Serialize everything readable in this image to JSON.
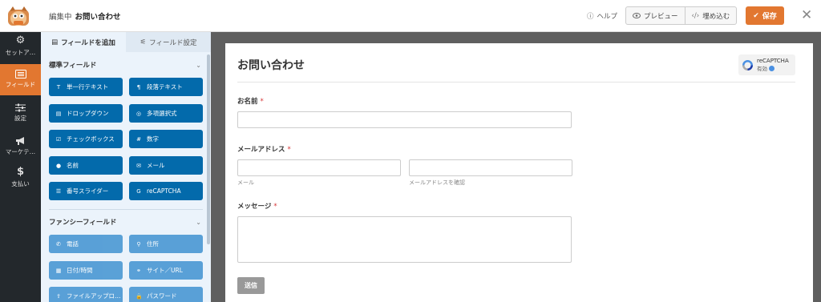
{
  "header": {
    "editing_label": "編集中",
    "form_name": "お問い合わせ",
    "help_label": "ヘルプ",
    "preview_label": "プレビュー",
    "embed_label": "埋め込む",
    "save_label": "保存",
    "close_label": "✕"
  },
  "leftnav": {
    "items": [
      {
        "label": "セットア…",
        "icon": "gear-icon"
      },
      {
        "label": "フィールド",
        "icon": "fields-icon"
      },
      {
        "label": "設定",
        "icon": "sliders-icon"
      },
      {
        "label": "マーケテ…",
        "icon": "megaphone-icon"
      },
      {
        "label": "支払い",
        "icon": "dollar-icon"
      }
    ],
    "active_index": 1
  },
  "panel": {
    "tabs": [
      "フィールドを追加",
      "フィールド設定"
    ],
    "standard_title": "標準フィールド",
    "standard_fields": [
      {
        "label": "単一行テキスト",
        "glyph": "T"
      },
      {
        "label": "段落テキスト",
        "glyph": "¶"
      },
      {
        "label": "ドロップダウン",
        "glyph": "▤"
      },
      {
        "label": "多項選択式",
        "glyph": "◎"
      },
      {
        "label": "チェックボックス",
        "glyph": "☑"
      },
      {
        "label": "数字",
        "glyph": "#"
      },
      {
        "label": "名前",
        "glyph": "●"
      },
      {
        "label": "メール",
        "glyph": "✉"
      },
      {
        "label": "番号スライダー",
        "glyph": "☰"
      },
      {
        "label": "reCAPTCHA",
        "glyph": "G"
      }
    ],
    "fancy_title": "ファンシーフィールド",
    "fancy_fields": [
      {
        "label": "電話",
        "glyph": "✆"
      },
      {
        "label": "住所",
        "glyph": "⚲"
      },
      {
        "label": "日付/時間",
        "glyph": "▦"
      },
      {
        "label": "サイト／URL",
        "glyph": "⚭"
      },
      {
        "label": "ファイルアップロ…",
        "glyph": "⇪"
      },
      {
        "label": "パスワード",
        "glyph": "🔒"
      }
    ]
  },
  "form": {
    "title": "お問い合わせ",
    "recaptcha_label": "reCAPTCHA",
    "recaptcha_status": "有効",
    "name_label": "お名前",
    "required_mark": "*",
    "email_label": "メールアドレス",
    "email_sub": "メール",
    "email_confirm_sub": "メールアドレスを確認",
    "message_label": "メッセージ",
    "submit_label": "送信"
  },
  "colors": {
    "accent": "#e27730",
    "nav_bg": "#23282c",
    "field_button": "#036aab",
    "fancy_button": "#4d9ad4"
  }
}
